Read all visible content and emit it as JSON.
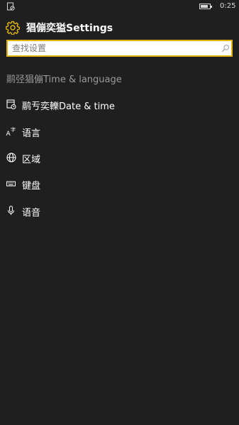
{
  "status_bar": {
    "time": "0:25"
  },
  "header": {
    "title": "猖傰奕獈Settings"
  },
  "search": {
    "placeholder": "查找设置"
  },
  "section": {
    "title": "鹝弪猖傰Time & language"
  },
  "items": [
    {
      "label": "鹝亐奕轢Date & time",
      "icon": "date-time-icon"
    },
    {
      "label": "语言",
      "icon": "language-icon"
    },
    {
      "label": "区域",
      "icon": "globe-icon"
    },
    {
      "label": "键盘",
      "icon": "keyboard-icon"
    },
    {
      "label": "语音",
      "icon": "microphone-icon"
    }
  ],
  "colors": {
    "accent": "#e3b50c",
    "background": "#1f1f1f",
    "section_text": "#9a9a9a"
  }
}
